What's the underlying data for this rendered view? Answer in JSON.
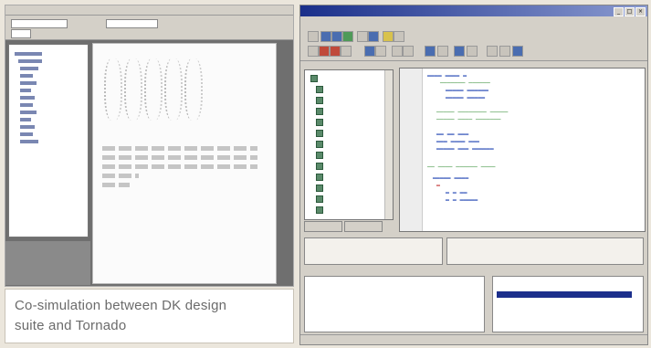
{
  "caption": {
    "line1": "Co-simulation between DK design",
    "line2": "suite and Tornado"
  },
  "tornado": {
    "title": "",
    "menu": [],
    "tree_items": [],
    "tabs": [],
    "status": ""
  },
  "colors": {
    "titlebar": "#1a2f8a",
    "selection": "#1c2f8c",
    "caption_text": "#6b6b6b"
  }
}
